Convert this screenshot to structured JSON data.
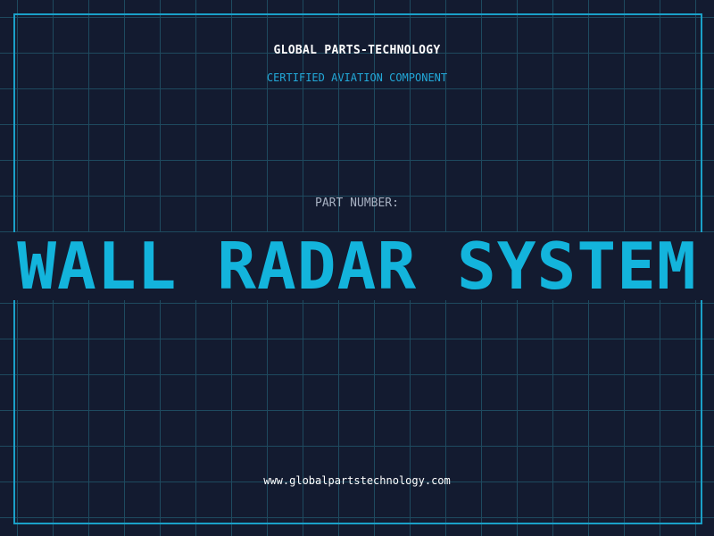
{
  "header": {
    "company": "GLOBAL PARTS-TECHNOLOGY",
    "tagline": "CERTIFIED AVIATION COMPONENT"
  },
  "part": {
    "label": "PART NUMBER:",
    "name": "WALL RADAR SYSTEM"
  },
  "footer": {
    "website": "www.globalpartstechnology.com"
  },
  "colors": {
    "background": "#131b30",
    "grid": "#1e4a5f",
    "accent": "#13b4dc",
    "frame": "#1aa0c8"
  }
}
